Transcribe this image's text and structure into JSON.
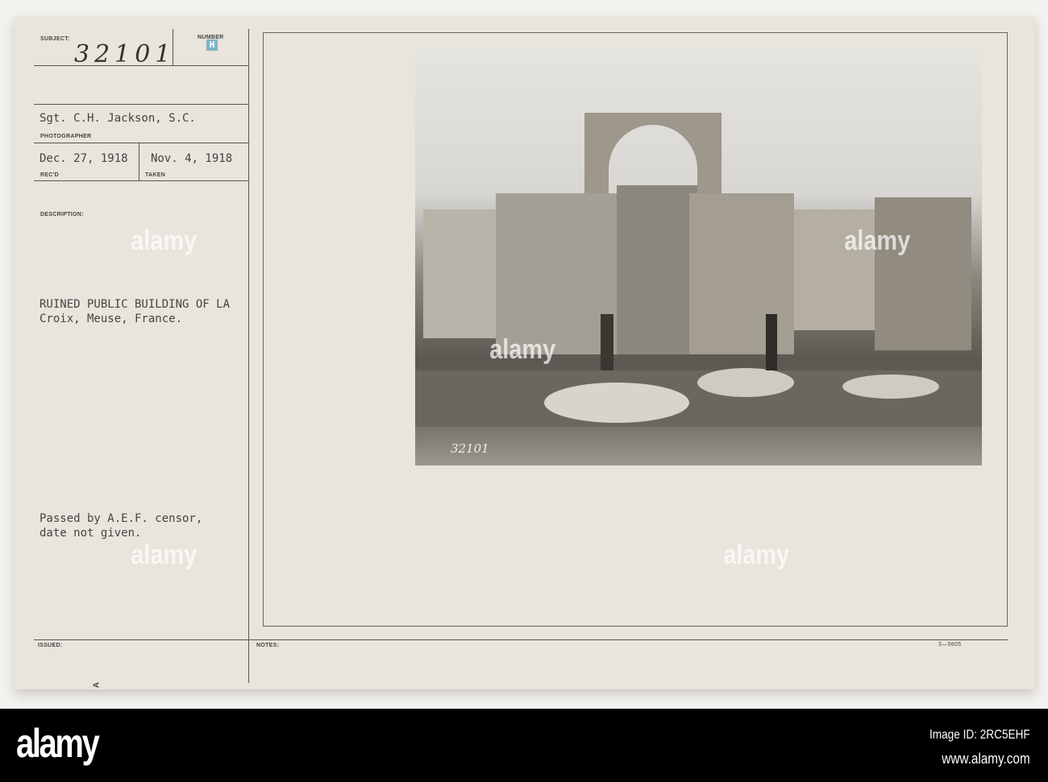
{
  "card": {
    "labels": {
      "subject": "SUBJECT:",
      "number": "NUMBER",
      "photographer": "PHOTOGRAPHER",
      "recd": "REC'D",
      "taken": "TAKEN",
      "description": "DESCRIPTION:",
      "issued": "ISSUED:",
      "notes": "NOTES:"
    },
    "subject_number": "32101",
    "number_stamp": "H",
    "photographer": "Sgt. C.H. Jackson, S.C.",
    "received": "Dec. 27, 1918",
    "taken": "Nov. 4, 1918",
    "description_line1": "RUINED PUBLIC BUILDING OF LA",
    "description_line2": "Croix, Meuse, France.",
    "censor_line1": "Passed by A.E.F. censor,",
    "censor_line2": "date not given.",
    "form_code": "3—5605",
    "photo_number": "32101",
    "corner_mark": "A"
  },
  "watermark": "alamy",
  "footer": {
    "logo": "alamy",
    "image_id": "Image ID: 2RC5EHF",
    "site": "www.alamy.com"
  }
}
